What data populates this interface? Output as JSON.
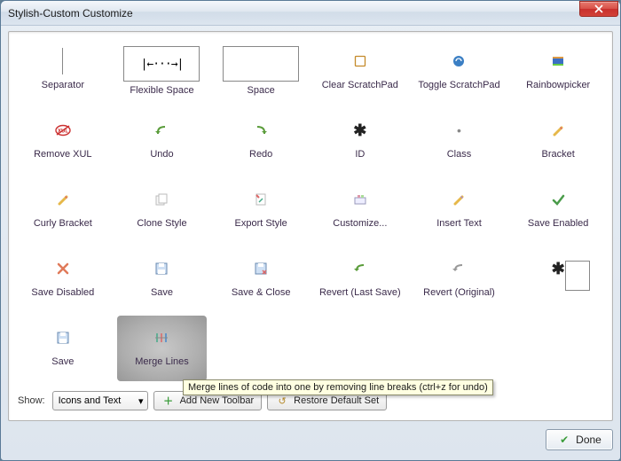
{
  "window": {
    "title": "Stylish-Custom Customize"
  },
  "items": [
    {
      "label": "Separator",
      "icon": "separator-icon",
      "variant": "sep"
    },
    {
      "label": "Flexible Space",
      "icon": "flex-space-icon",
      "variant": "flexbox"
    },
    {
      "label": "Space",
      "icon": "space-icon",
      "variant": "bigbox"
    },
    {
      "label": "Clear ScratchPad",
      "icon": "clear-scratchpad-icon"
    },
    {
      "label": "Toggle ScratchPad",
      "icon": "toggle-scratchpad-icon"
    },
    {
      "label": "Rainbowpicker",
      "icon": "rainbowpicker-icon"
    },
    {
      "label": "Remove XUL",
      "icon": "remove-xul-icon"
    },
    {
      "label": "Undo",
      "icon": "undo-icon"
    },
    {
      "label": "Redo",
      "icon": "redo-icon"
    },
    {
      "label": "ID",
      "icon": "id-icon"
    },
    {
      "label": "Class",
      "icon": "class-icon"
    },
    {
      "label": "Bracket",
      "icon": "bracket-icon"
    },
    {
      "label": "Curly Bracket",
      "icon": "curly-bracket-icon"
    },
    {
      "label": "Clone Style",
      "icon": "clone-style-icon"
    },
    {
      "label": "Export Style",
      "icon": "export-style-icon"
    },
    {
      "label": "Customize...",
      "icon": "customize-icon"
    },
    {
      "label": "Insert Text",
      "icon": "insert-text-icon"
    },
    {
      "label": "Save Enabled",
      "icon": "save-enabled-icon"
    },
    {
      "label": "Save Disabled",
      "icon": "save-disabled-icon"
    },
    {
      "label": "Save",
      "icon": "save-icon"
    },
    {
      "label": "Save & Close",
      "icon": "save-close-icon"
    },
    {
      "label": "Revert (Last Save)",
      "icon": "revert-last-icon"
    },
    {
      "label": "Revert (Original)",
      "icon": "revert-original-icon"
    },
    {
      "label": "",
      "icon": "id-box-icon",
      "variant": "idbox"
    },
    {
      "label": "Save",
      "icon": "save-alt-icon"
    },
    {
      "label": "Merge Lines",
      "icon": "merge-lines-icon",
      "hover": true
    }
  ],
  "tooltip": "Merge lines of code into one by removing line breaks (ctrl+z for undo)",
  "bottomBar": {
    "showLabel": "Show:",
    "comboValue": "Icons and Text",
    "addToolbar": "Add New Toolbar",
    "restore": "Restore Default Set"
  },
  "footer": {
    "done": "Done"
  }
}
